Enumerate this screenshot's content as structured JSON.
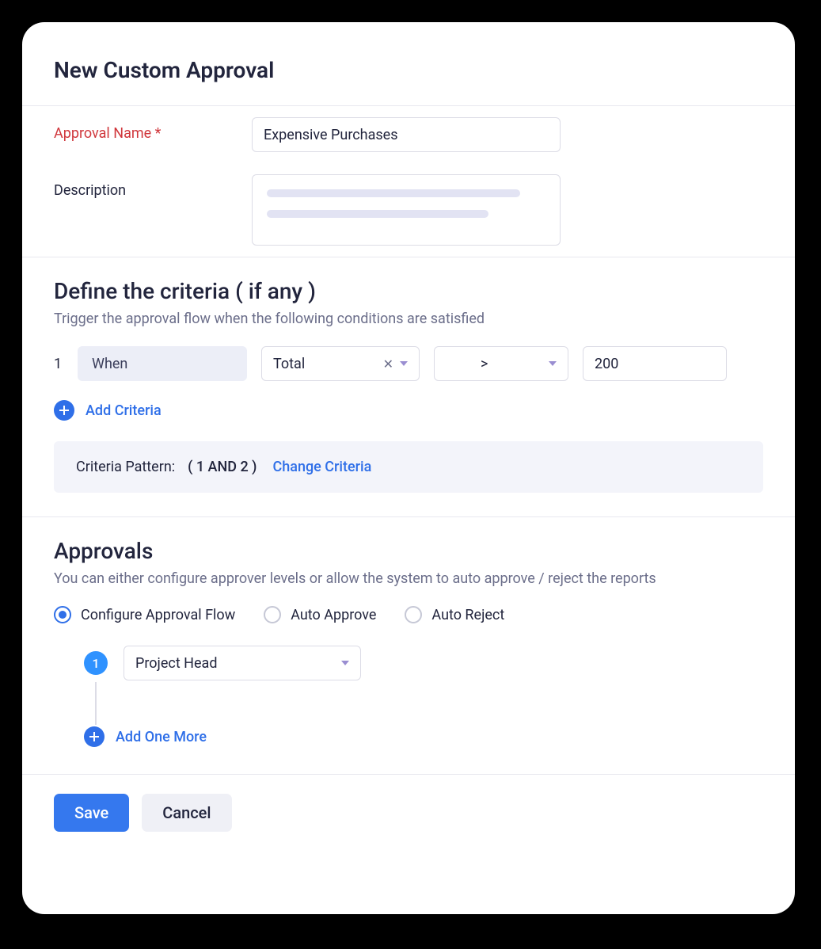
{
  "header": {
    "title": "New Custom Approval"
  },
  "form": {
    "name_label": "Approval Name *",
    "name_value": "Expensive Purchases",
    "desc_label": "Description"
  },
  "criteria": {
    "heading": "Define the criteria ( if any )",
    "hint": "Trigger the approval flow when the following conditions are satisfied",
    "rows": [
      {
        "index": "1",
        "when": "When",
        "field": "Total",
        "op": ">",
        "value": "200"
      }
    ],
    "add_label": "Add Criteria",
    "pattern_label": "Criteria Pattern:",
    "pattern_value": "( 1 AND 2 )",
    "change_label": "Change Criteria"
  },
  "approvals": {
    "heading": "Approvals",
    "hint": "You can either configure approver levels  or allow the system to auto approve / reject the reports",
    "radios": [
      {
        "label": "Configure Approval Flow",
        "selected": true
      },
      {
        "label": "Auto Approve",
        "selected": false
      },
      {
        "label": "Auto Reject",
        "selected": false
      }
    ],
    "steps": [
      {
        "badge": "1",
        "approver": "Project Head"
      }
    ],
    "add_label": "Add One More"
  },
  "footer": {
    "save": "Save",
    "cancel": "Cancel"
  }
}
